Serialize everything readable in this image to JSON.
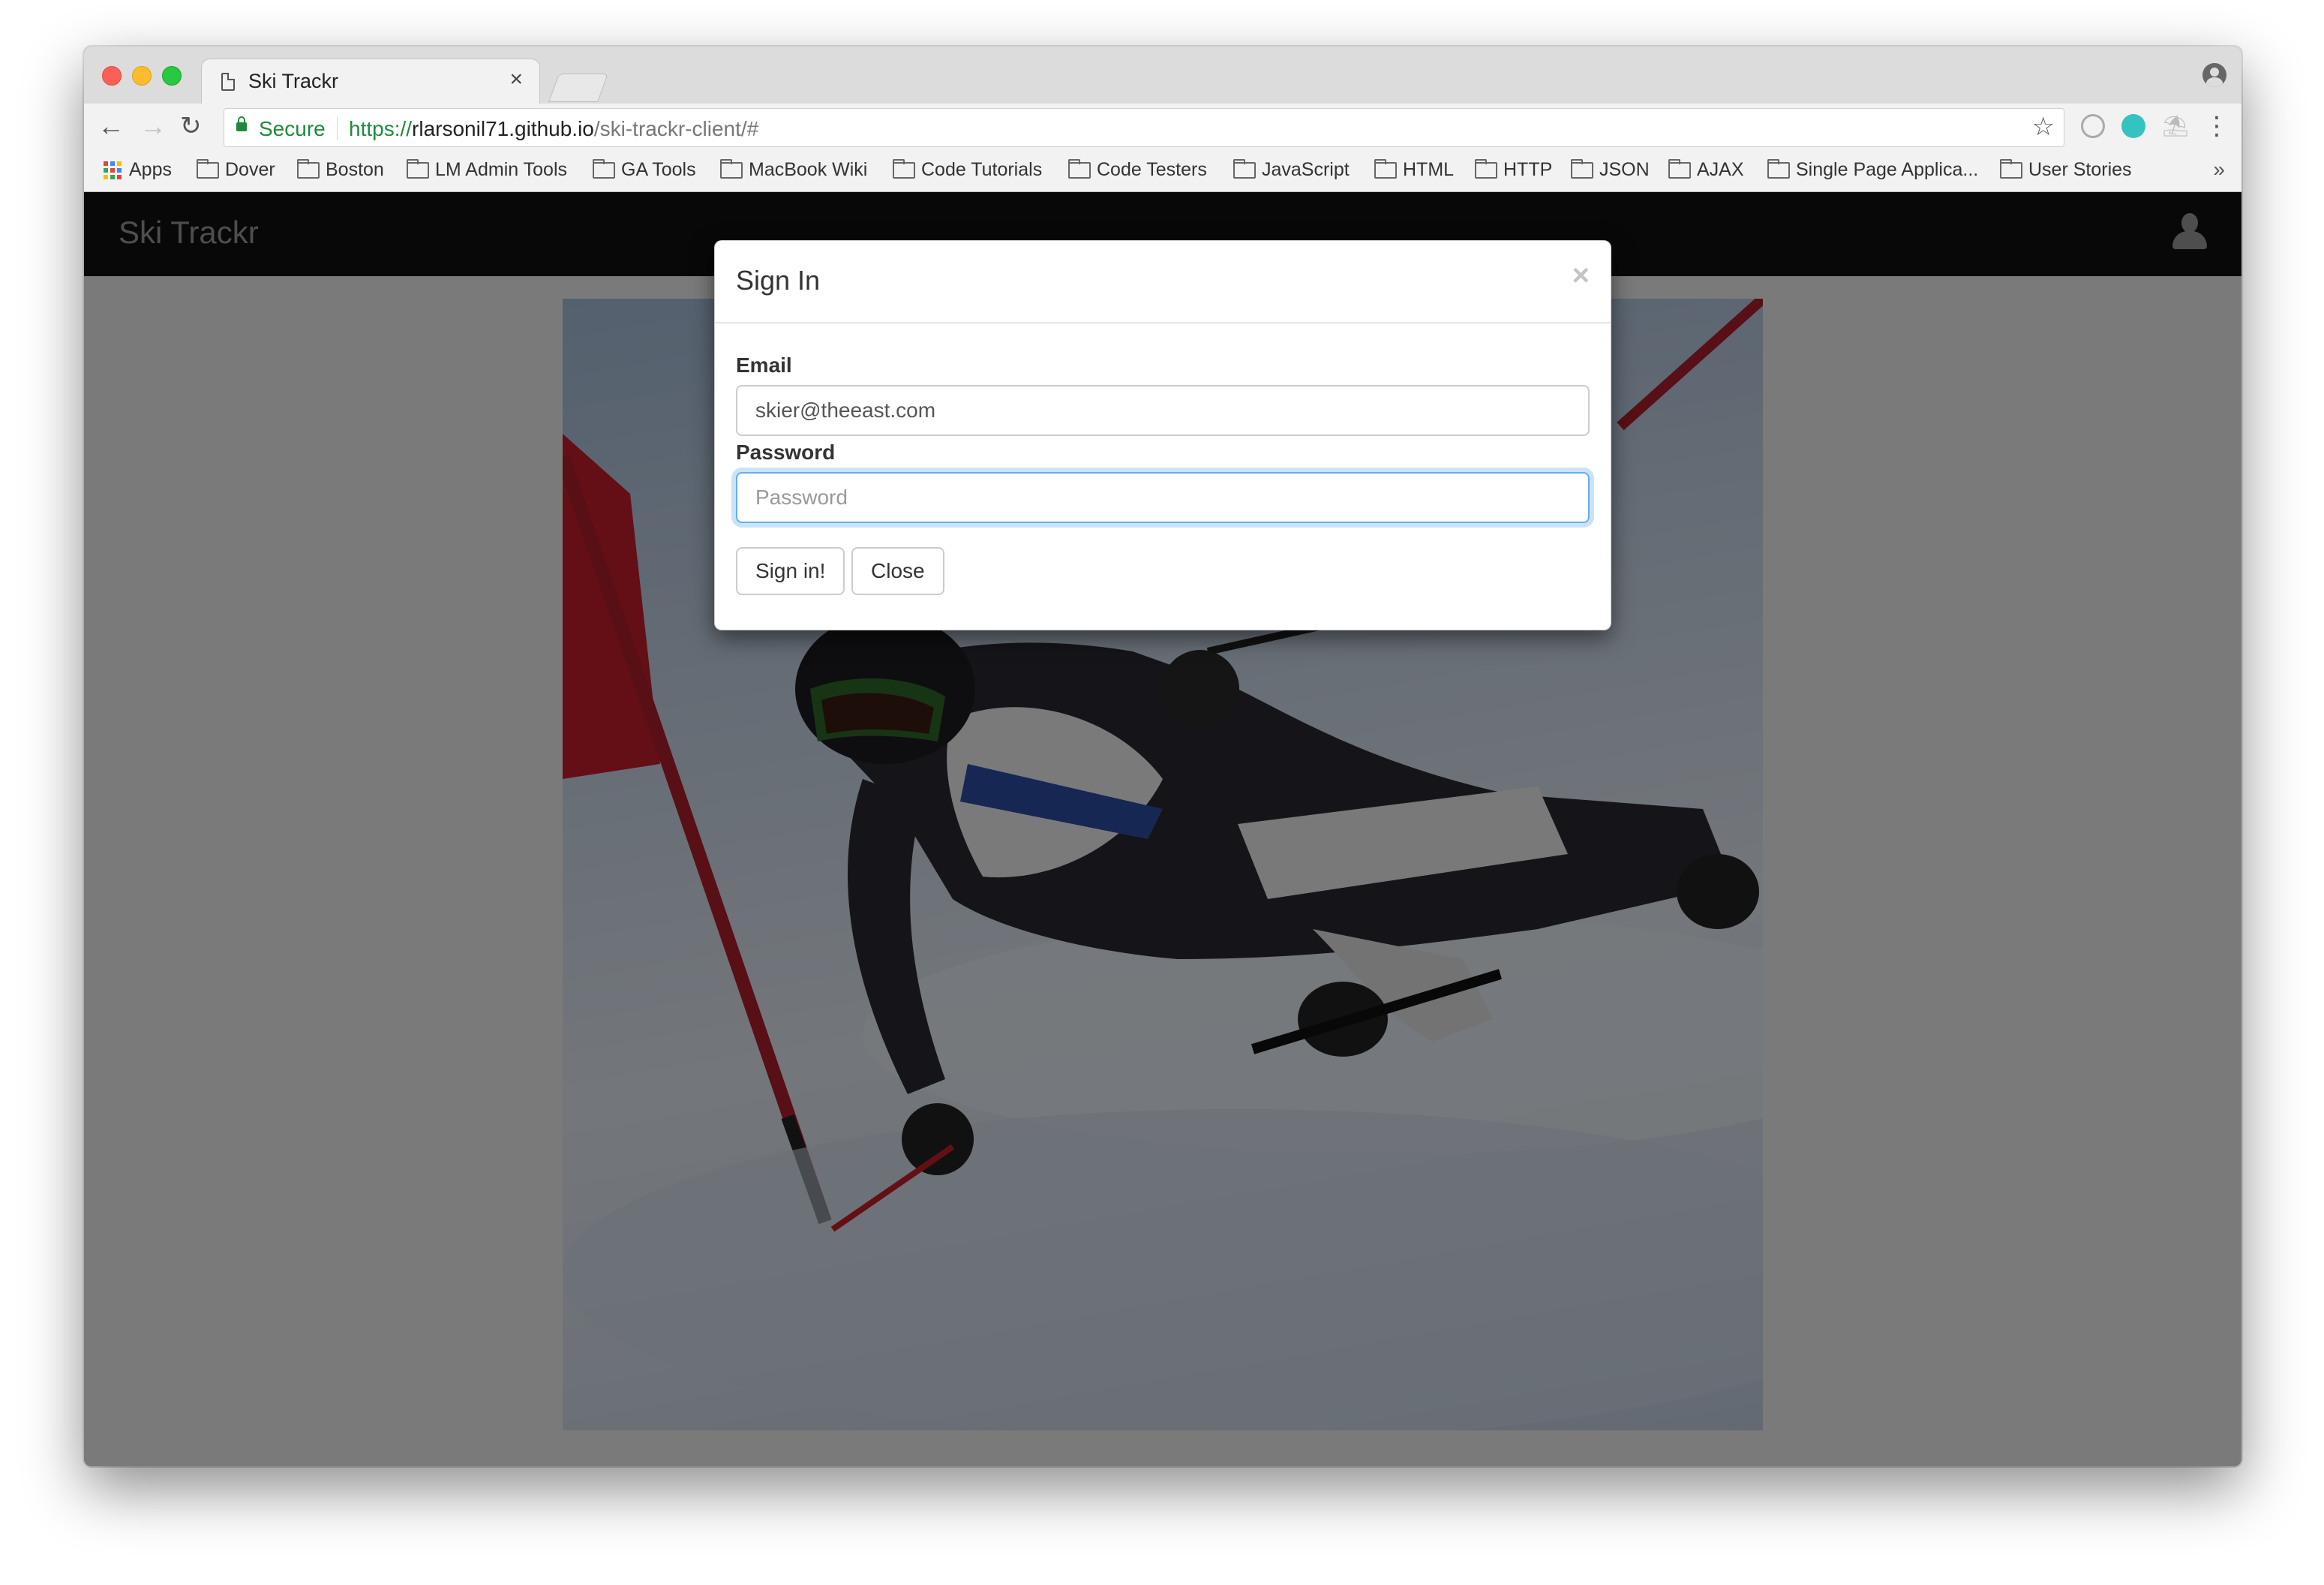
{
  "browser": {
    "tab_title": "Ski Trackr",
    "tab_close": "×",
    "secure_label": "Secure",
    "url_scheme": "https://",
    "url_host": "rlarsonil71.github.io",
    "url_path": "/ski-trackr-client/#",
    "bookmarks": [
      "Apps",
      "Dover",
      "Boston",
      "LM Admin Tools",
      "GA Tools",
      "MacBook Wiki",
      "Code Tutorials",
      "Code Testers",
      "JavaScript",
      "HTML",
      "HTTP",
      "JSON",
      "AJAX",
      "Single Page Applica...",
      "User Stories"
    ],
    "bookmarks_more": "»",
    "icons": {
      "back": "←",
      "forward": "→",
      "reload": "↻",
      "star": "☆",
      "menu": "⋮"
    }
  },
  "app": {
    "brand": "Ski Trackr"
  },
  "modal": {
    "title": "Sign In",
    "close": "×",
    "email_label": "Email",
    "email_value": "skier@theeast.com",
    "password_label": "Password",
    "password_placeholder": "Password",
    "signin_button": "Sign in!",
    "close_button": "Close"
  },
  "colors": {
    "navbar_bg": "#101010",
    "brand_text": "#9d9d9d",
    "secure_green": "#1e8a3c",
    "focus_border": "#66afe9"
  }
}
